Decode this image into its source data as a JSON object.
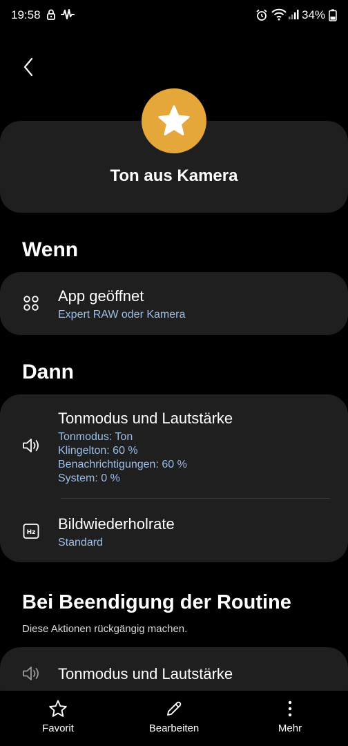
{
  "status_bar": {
    "time": "19:58",
    "battery": "34%",
    "icons": [
      "lock-icon",
      "pulse-icon",
      "alarm-icon",
      "wifi-icon",
      "signal-icon",
      "battery-icon"
    ]
  },
  "header": {
    "icon": "star-icon",
    "icon_color": "#e6a73a",
    "title": "Ton aus Kamera"
  },
  "wenn": {
    "title": "Wenn",
    "items": [
      {
        "icon": "apps-icon",
        "title": "App geöffnet",
        "subtitle": "Expert RAW oder Kamera"
      }
    ]
  },
  "dann": {
    "title": "Dann",
    "items": [
      {
        "icon": "volume-icon",
        "title": "Tonmodus und Lautstärke",
        "details": [
          "Tonmodus: Ton",
          "Klingelton: 60 %",
          "Benachrichtigungen: 60 %",
          "System: 0 %"
        ]
      },
      {
        "icon": "hz-icon",
        "title": "Bildwiederholrate",
        "subtitle": "Standard"
      }
    ]
  },
  "ende": {
    "title": "Bei Beendigung der Routine",
    "subtitle": "Diese Aktionen rückgängig machen.",
    "items": [
      {
        "icon": "volume-icon",
        "title": "Tonmodus und Lautstärke"
      }
    ]
  },
  "bottom_nav": {
    "favorit": "Favorit",
    "bearbeiten": "Bearbeiten",
    "mehr": "Mehr"
  },
  "colors": {
    "background": "#000000",
    "card": "#1f1f1f",
    "accent_text": "#9cbfe8",
    "star_circle": "#e6a73a"
  }
}
